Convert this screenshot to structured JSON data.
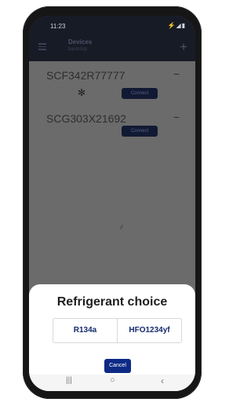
{
  "status": {
    "time": "11:23",
    "icons": "⚡◢▮"
  },
  "appbar": {
    "title": "Devices",
    "subtitle": "backstop",
    "add_icon": "+"
  },
  "devices": [
    {
      "name": "SCF342R77777",
      "status": "−",
      "connect_label": "Connect",
      "gear_icon": "gear-icon"
    },
    {
      "name": "SCG303X21692",
      "status": "−",
      "connect_label": "Connect"
    }
  ],
  "sheet": {
    "title": "Refrigerant choice",
    "choices": [
      "R134a",
      "HFO1234yf"
    ],
    "cancel_label": "Cancel"
  },
  "navbar": {
    "recent": "|||",
    "home": "○",
    "back": "‹"
  },
  "colors": {
    "appbar_bg": "#171b26",
    "content_overlay": "#6b6b6b",
    "button_bg": "#0d2a86",
    "choice_text": "#142a6e"
  }
}
